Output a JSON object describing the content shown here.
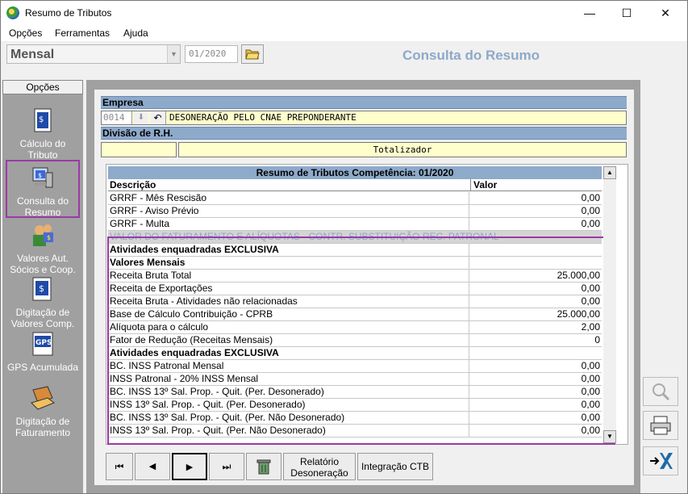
{
  "window": {
    "title": "Resumo de Tributos",
    "minimize": "—",
    "maximize": "☐",
    "close": "✕"
  },
  "menu": {
    "items": [
      "Opções",
      "Ferramentas",
      "Ajuda"
    ]
  },
  "toolbar": {
    "period": "Mensal",
    "competencia": "01/2020",
    "heading": "Consulta do Resumo"
  },
  "sidebar": {
    "header": "Opções",
    "items": [
      {
        "label": "Cálculo do Tributo",
        "icon": "document-calc-icon"
      },
      {
        "label": "Consulta do Resumo",
        "icon": "computer-consult-icon"
      },
      {
        "label": "Valores Aut. Sócios e Coop.",
        "icon": "partners-icon"
      },
      {
        "label": "Digitação de Valores Comp.",
        "icon": "document-dollar-icon"
      },
      {
        "label": "GPS Acumulada",
        "icon": "gps-icon"
      },
      {
        "label": "Digitação de Faturamento",
        "icon": "laptop-icon"
      }
    ]
  },
  "empresa": {
    "label": "Empresa",
    "code": "0014",
    "name": "DESONERAÇÃO PELO CNAE PREPONDERANTE",
    "divisao_label": "Divisão de R.H.",
    "totalizador": "Totalizador"
  },
  "grid": {
    "title": "Resumo de Tributos Competência: 01/2020",
    "col_desc": "Descrição",
    "col_valor": "Valor",
    "rows": [
      {
        "d": "GRRF - Mês Rescisão",
        "v": "0,00"
      },
      {
        "d": "GRRF - Aviso Prévio",
        "v": "0,00"
      },
      {
        "d": "GRRF - Multa",
        "v": "0,00"
      },
      {
        "d": "VALOR DO FATURAMENTO E ALÍQUOTAS - CONTR. SUBSTITUIÇÃO REC. PATRONAL",
        "v": ""
      },
      {
        "d": "Atividades enquadradas EXCLUSIVA",
        "v": ""
      },
      {
        "d": "Valores Mensais",
        "v": ""
      },
      {
        "d": "Receita Bruta Total",
        "v": "25.000,00"
      },
      {
        "d": "Receita de Exportações",
        "v": "0,00"
      },
      {
        "d": "Receita Bruta - Atividades não relacionadas",
        "v": "0,00"
      },
      {
        "d": "Base de Cálculo Contribuição - CPRB",
        "v": "25.000,00"
      },
      {
        "d": "Alíquota para o cálculo",
        "v": "2,00"
      },
      {
        "d": "Fator de Redução (Receitas Mensais)",
        "v": "0"
      },
      {
        "d": "Atividades enquadradas EXCLUSIVA",
        "v": ""
      },
      {
        "d": "BC. INSS Patronal Mensal",
        "v": "0,00"
      },
      {
        "d": "INSS Patronal - 20% INSS Mensal",
        "v": "0,00"
      },
      {
        "d": "BC. INSS 13º Sal. Prop. - Quit. (Per. Desonerado)",
        "v": "0,00"
      },
      {
        "d": "INSS 13º Sal. Prop. - Quit. (Per. Desonerado)",
        "v": "0,00"
      },
      {
        "d": "BC. INSS 13º Sal. Prop. - Quit. (Per. Não Desonerado)",
        "v": "0,00"
      },
      {
        "d": "INSS 13º Sal. Prop. - Quit. (Per. Não Desonerado)",
        "v": "0,00"
      }
    ]
  },
  "nav": {
    "first": "⏮",
    "prev": "◀",
    "next": "▶",
    "last": "⏭",
    "relatorio_l1": "Relatório",
    "relatorio_l2": "Desoneração",
    "integracao": "Integração CTB"
  },
  "colors": {
    "accent": "#8eaacb",
    "highlight": "#9b3aa4",
    "yellow": "#ffffcc"
  }
}
